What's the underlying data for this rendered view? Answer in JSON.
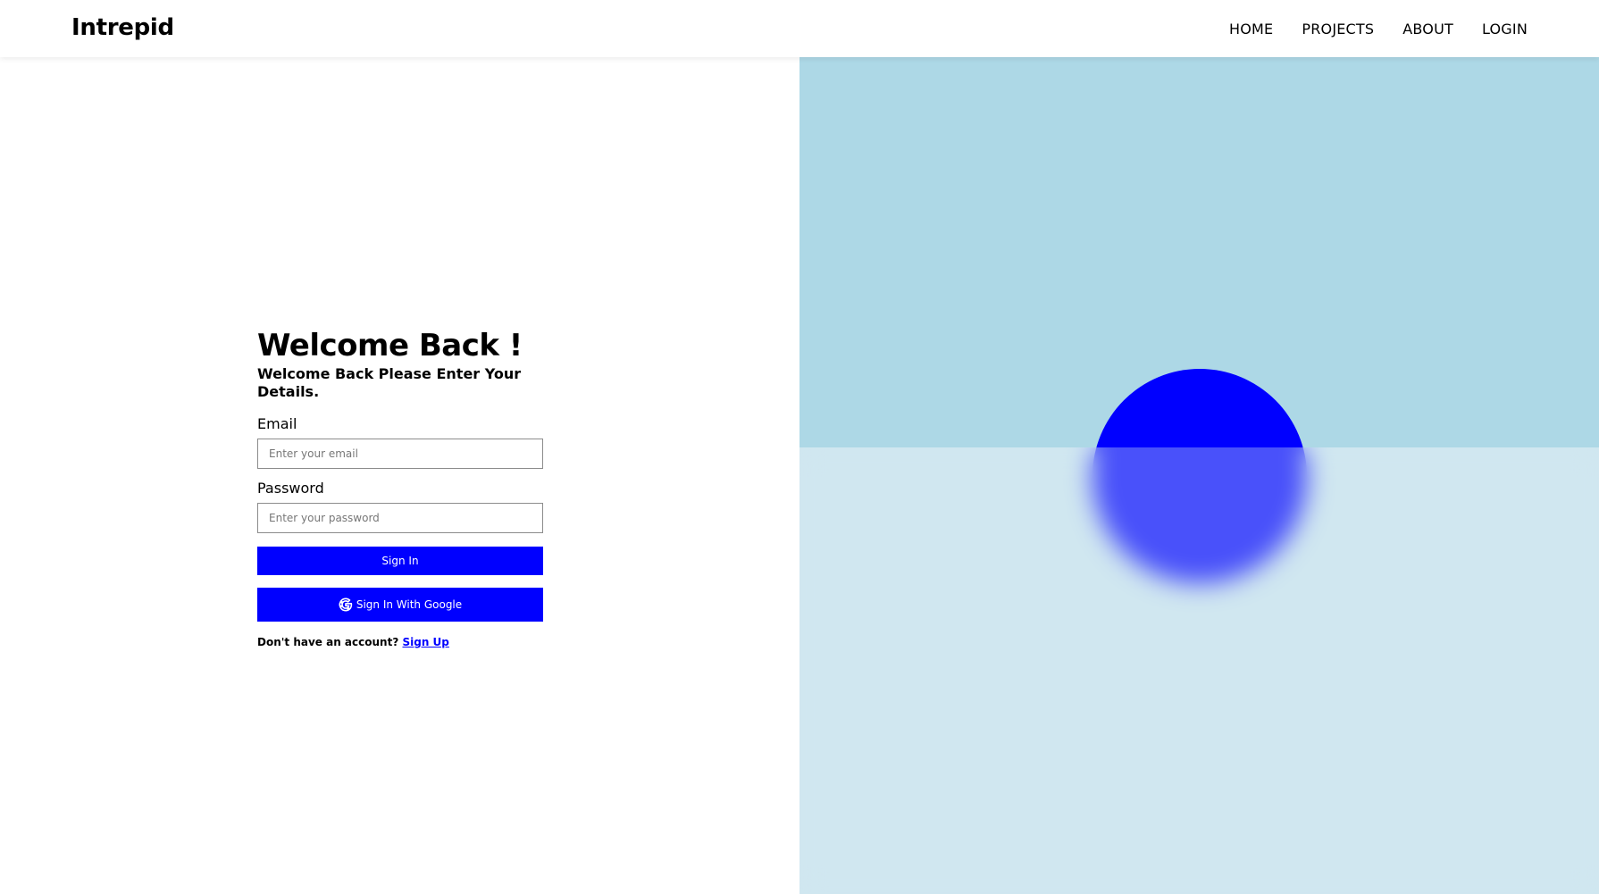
{
  "brand": {
    "name": "Intrepid"
  },
  "nav": {
    "items": [
      {
        "label": "HOME"
      },
      {
        "label": "PROJECTS"
      },
      {
        "label": "ABOUT"
      },
      {
        "label": "LOGIN"
      }
    ]
  },
  "login": {
    "title": "Welcome Back !",
    "subtitle": "Welcome Back Please Enter Your Details.",
    "email": {
      "label": "Email",
      "placeholder": "Enter your email",
      "value": ""
    },
    "password": {
      "label": "Password",
      "placeholder": "Enter your password",
      "value": ""
    },
    "signin_label": "Sign In",
    "google_label": "Sign In With Google",
    "google_icon": "google-g-icon",
    "signup_prompt": "Don't have an account?",
    "signup_link": "Sign Up"
  },
  "colors": {
    "accent": "#0000ff",
    "sky": "#add8e6",
    "glass": "#cfe6f0"
  }
}
